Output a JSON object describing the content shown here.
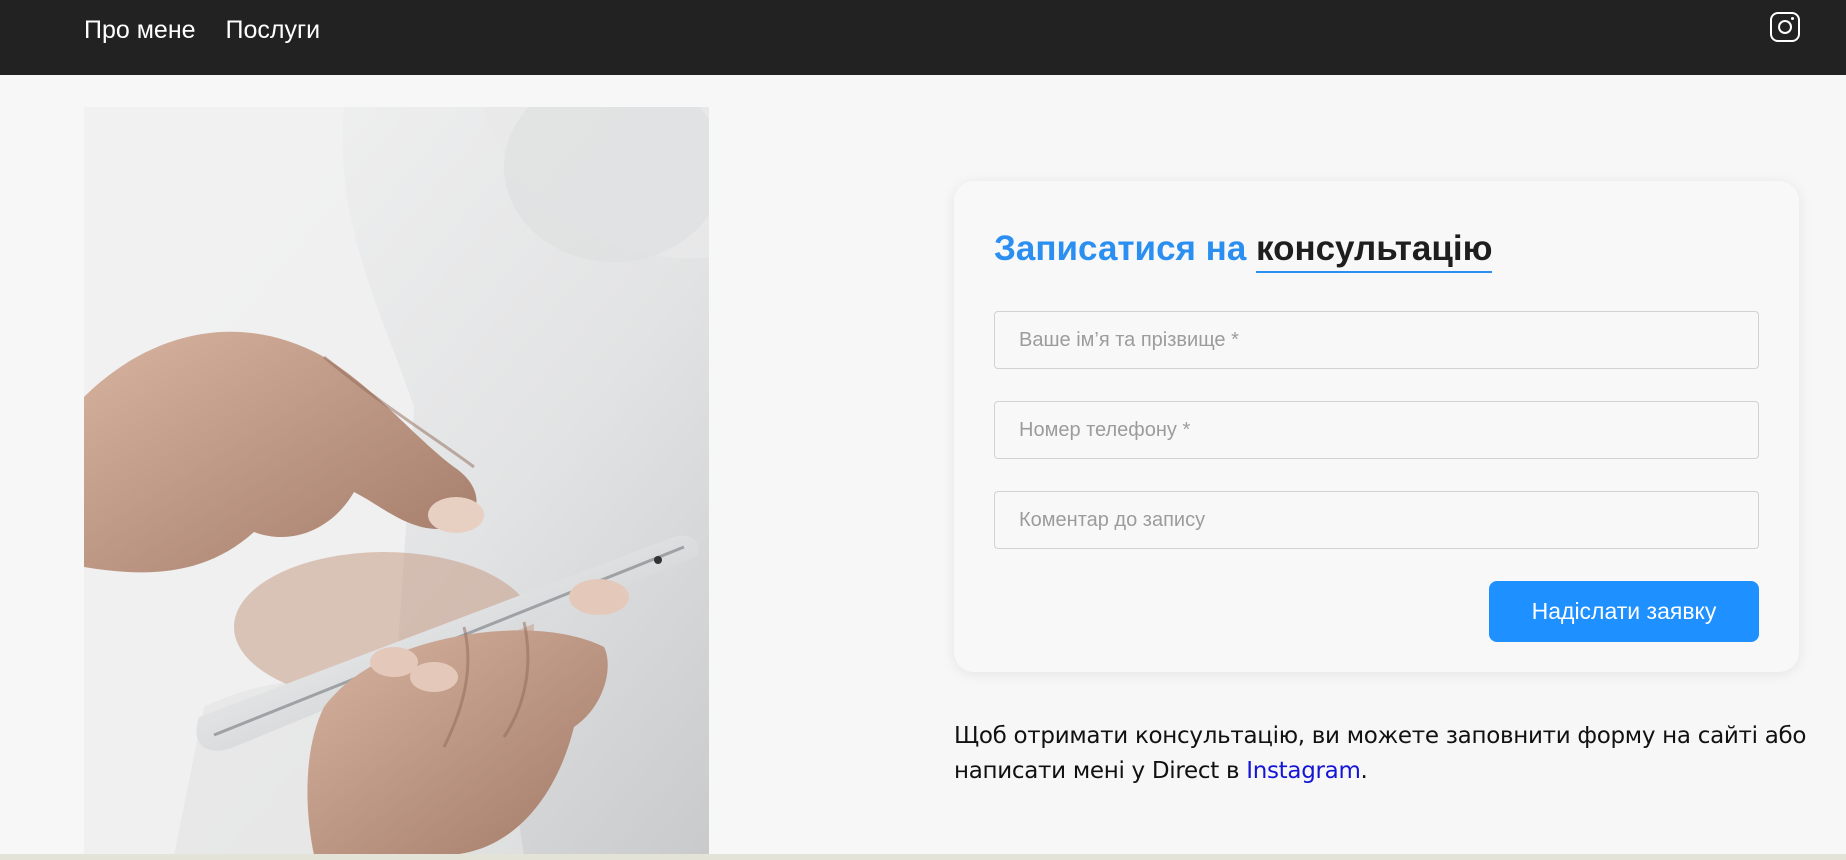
{
  "header": {
    "nav": [
      {
        "label": "Про мене"
      },
      {
        "label": "Послуги"
      }
    ],
    "social_icon": "instagram-icon"
  },
  "hero": {
    "image_subject": "hand tapping smartphone screen"
  },
  "form": {
    "title_accent": "Записатися на",
    "title_main": "консультацію",
    "fields": [
      {
        "placeholder": "Ваше ім’я та прізвище *",
        "value": ""
      },
      {
        "placeholder": "Номер телефону *",
        "value": ""
      },
      {
        "placeholder": "Коментар до запису",
        "value": ""
      }
    ],
    "submit_label": "Надіслати заявку"
  },
  "info": {
    "text_before": "Щоб отримати консультацію, ви можете заповнити форму на сайті або написати мені у Direct в ",
    "link_text": "Instagram",
    "text_after": "."
  },
  "colors": {
    "header_bg": "#222222",
    "accent": "#2a8ff0",
    "button_bg": "#1e90ff",
    "link": "#1515d6",
    "page_bg": "#f7f7f7"
  }
}
